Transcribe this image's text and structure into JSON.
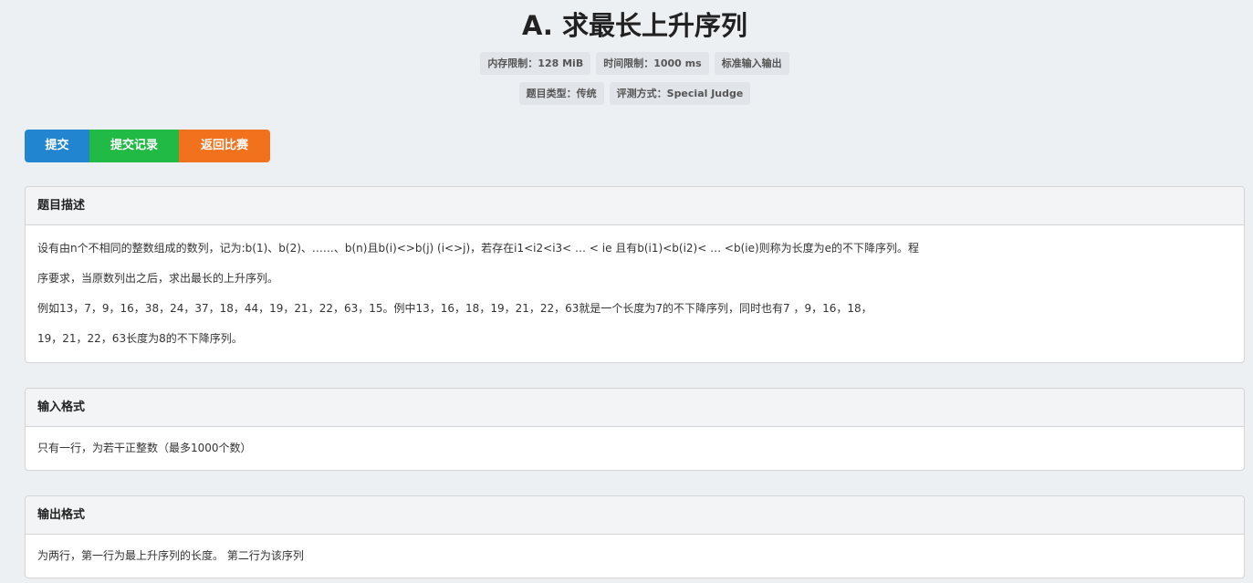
{
  "problem": {
    "title": "A. 求最长上升序列",
    "meta_row1": [
      "内存限制：128 MiB",
      "时间限制：1000 ms",
      "标准输入输出"
    ],
    "meta_row2": [
      "题目类型：传统",
      "评测方式：Special Judge"
    ]
  },
  "actions": {
    "submit_label": "提交",
    "records_label": "提交记录",
    "back_label": "返回比赛"
  },
  "sections": {
    "description": {
      "heading": "题目描述",
      "lines": [
        "设有由n个不相同的整数组成的数列，记为:b(1)、b(2)、……、b(n)且b(i)<>b(j) (i<>j)，若存在i1<i2<i3< … < ie 且有b(i1)<b(i2)< … <b(ie)则称为长度为e的不下降序列。程",
        "序要求，当原数列出之后，求出最长的上升序列。",
        "例如13，7，9，16，38，24，37，18，44，19，21，22，63，15。例中13，16，18，19，21，22，63就是一个长度为7的不下降序列，同时也有7 ，9，16，18，",
        "19，21，22，63长度为8的不下降序列。"
      ]
    },
    "input": {
      "heading": "输入格式",
      "text": "只有一行，为若干正整数（最多1000个数）"
    },
    "output": {
      "heading": "输出格式",
      "text": "为两行，第一行为最上升序列的长度。 第二行为该序列"
    }
  }
}
